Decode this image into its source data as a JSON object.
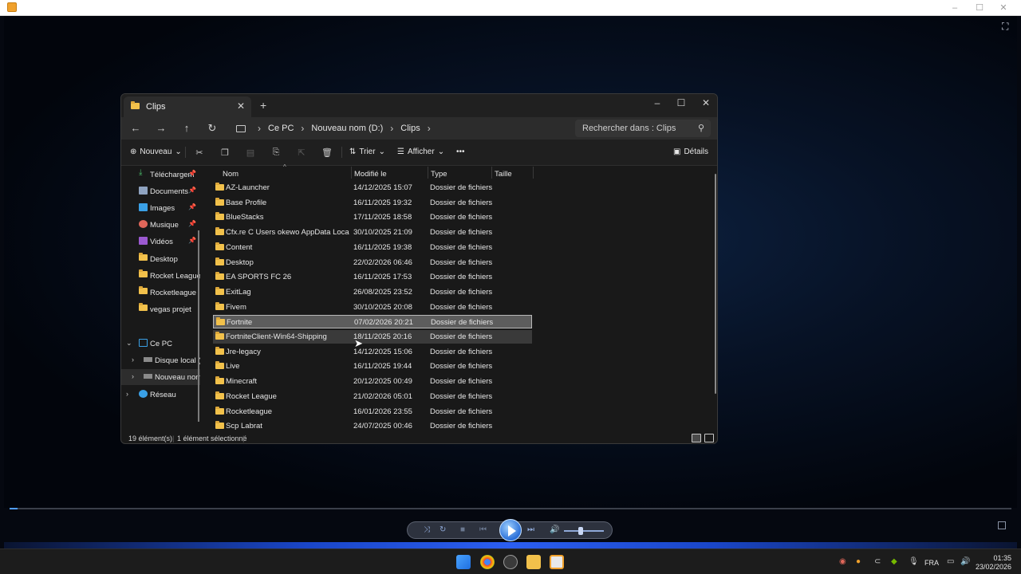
{
  "explorer": {
    "tab_title": "Clips",
    "breadcrumb": [
      "Ce PC",
      "Nouveau nom (D:)",
      "Clips"
    ],
    "search_placeholder": "Rechercher dans : Clips",
    "toolbar": {
      "new_label": "Nouveau",
      "sort_label": "Trier",
      "view_label": "Afficher",
      "details_label": "Détails"
    },
    "nav": {
      "quick_access": [
        {
          "label": "Téléchargem",
          "icon": "download-icon",
          "pinned": true
        },
        {
          "label": "Documents",
          "icon": "documents-icon",
          "pinned": true
        },
        {
          "label": "Images",
          "icon": "images-icon",
          "pinned": true
        },
        {
          "label": "Musique",
          "icon": "music-icon",
          "pinned": true
        },
        {
          "label": "Vidéos",
          "icon": "videos-icon",
          "pinned": true
        },
        {
          "label": "Desktop",
          "icon": "folder-icon",
          "pinned": false
        },
        {
          "label": "Rocket League",
          "icon": "folder-icon",
          "pinned": false
        },
        {
          "label": "Rocketleague",
          "icon": "folder-icon",
          "pinned": false
        },
        {
          "label": "vegas projet",
          "icon": "folder-icon",
          "pinned": false
        }
      ],
      "this_pc": "Ce PC",
      "drives": [
        "Disque local (C",
        "Nouveau nom"
      ],
      "network": "Réseau"
    },
    "columns": {
      "name": "Nom",
      "modified": "Modifié le",
      "type": "Type",
      "size": "Taille"
    },
    "rows": [
      {
        "name": "AZ-Launcher",
        "date": "14/12/2025 15:07",
        "type": "Dossier de fichiers"
      },
      {
        "name": "Base Profile",
        "date": "16/11/2025 19:32",
        "type": "Dossier de fichiers"
      },
      {
        "name": "BlueStacks",
        "date": "17/11/2025 18:58",
        "type": "Dossier de fichiers"
      },
      {
        "name": "Cfx.re C Users okewo AppData Local Fiv...",
        "date": "30/10/2025 21:09",
        "type": "Dossier de fichiers"
      },
      {
        "name": "Content",
        "date": "16/11/2025 19:38",
        "type": "Dossier de fichiers"
      },
      {
        "name": "Desktop",
        "date": "22/02/2026 06:46",
        "type": "Dossier de fichiers"
      },
      {
        "name": "EA SPORTS FC 26",
        "date": "16/11/2025 17:53",
        "type": "Dossier de fichiers"
      },
      {
        "name": "ExitLag",
        "date": "26/08/2025 23:52",
        "type": "Dossier de fichiers"
      },
      {
        "name": "Fivem",
        "date": "30/10/2025 20:08",
        "type": "Dossier de fichiers"
      },
      {
        "name": "Fortnite",
        "date": "07/02/2026 20:21",
        "type": "Dossier de fichiers"
      },
      {
        "name": "FortniteClient-Win64-Shipping",
        "date": "18/11/2025 20:16",
        "type": "Dossier de fichiers"
      },
      {
        "name": "Jre-legacy",
        "date": "14/12/2025 15:06",
        "type": "Dossier de fichiers"
      },
      {
        "name": "Live",
        "date": "16/11/2025 19:44",
        "type": "Dossier de fichiers"
      },
      {
        "name": "Minecraft",
        "date": "20/12/2025 00:49",
        "type": "Dossier de fichiers"
      },
      {
        "name": "Rocket League",
        "date": "21/02/2026 05:01",
        "type": "Dossier de fichiers"
      },
      {
        "name": "Rocketleague",
        "date": "16/01/2026 23:55",
        "type": "Dossier de fichiers"
      },
      {
        "name": "Scp Labrat",
        "date": "24/07/2025 00:46",
        "type": "Dossier de fichiers"
      }
    ],
    "status": {
      "count": "19 élément(s)",
      "selection": "1 élément sélectionné"
    }
  },
  "player": {
    "progress_percent": 0.8
  },
  "taskbar": {
    "language": "FRA",
    "time": "01:35",
    "date": "23/02/2026"
  },
  "colors": {
    "accent": "#4f9cff",
    "folder": "#f2c14b"
  }
}
